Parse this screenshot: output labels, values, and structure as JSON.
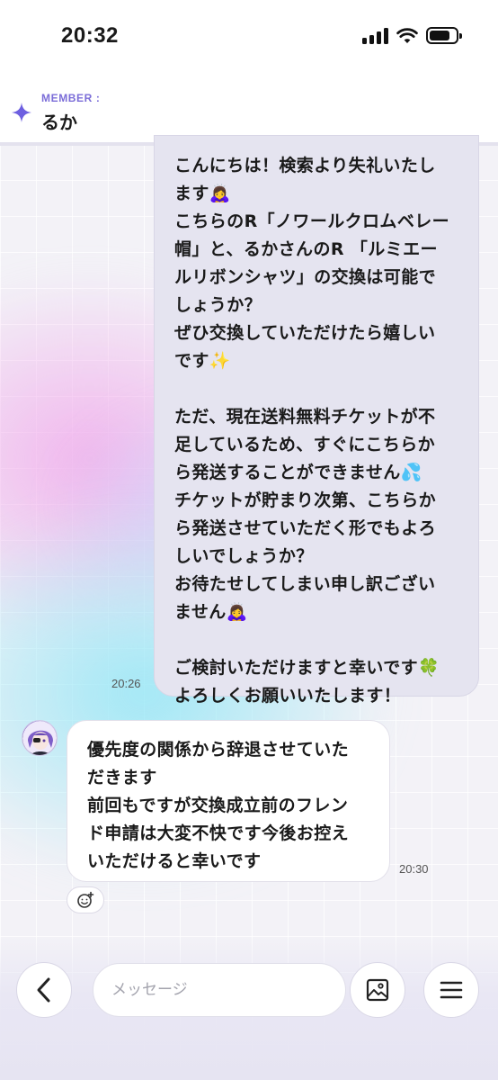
{
  "status_bar": {
    "time": "20:32"
  },
  "header": {
    "member_label": "MEMBER :",
    "member_name": "るか"
  },
  "messages": {
    "sent": {
      "lines": [
        "こんにちは！検索より失礼いたし",
        "ます🙇‍♀️",
        "こちらのR「ノワールクロムベレー",
        "帽」と、るかさんのR 「ルミエー",
        "ルリボンシャツ」の交換は可能で",
        "しょうか？",
        "ぜひ交換していただけたら嬉しい",
        "です✨",
        "",
        "ただ、現在送料無料チケットが不",
        "足しているため、すぐにこちらか",
        "ら発送することができません💦",
        "チケットが貯まり次第、こちらか",
        "ら発送させていただく形でもよろ",
        "しいでしょうか？",
        "お待たせしてしまい申し訳ござい",
        "ません🙇‍♀️",
        "",
        "ご検討いただけますと幸いです🍀",
        "よろしくお願いいたします！"
      ],
      "time": "20:26"
    },
    "received": {
      "lines": [
        "優先度の関係から辞退させていた",
        "だきます",
        "前回もですが交換成立前のフレン",
        "ド申請は大変不快です今後お控え",
        "いただけると幸いです"
      ],
      "time": "20:30",
      "reaction_icon": "add-reaction-icon"
    }
  },
  "input": {
    "placeholder": "メッセージ"
  },
  "colors": {
    "accent": "#7b6dd8",
    "sent_bubble": "#e5e4f0",
    "received_bubble": "#ffffff"
  }
}
